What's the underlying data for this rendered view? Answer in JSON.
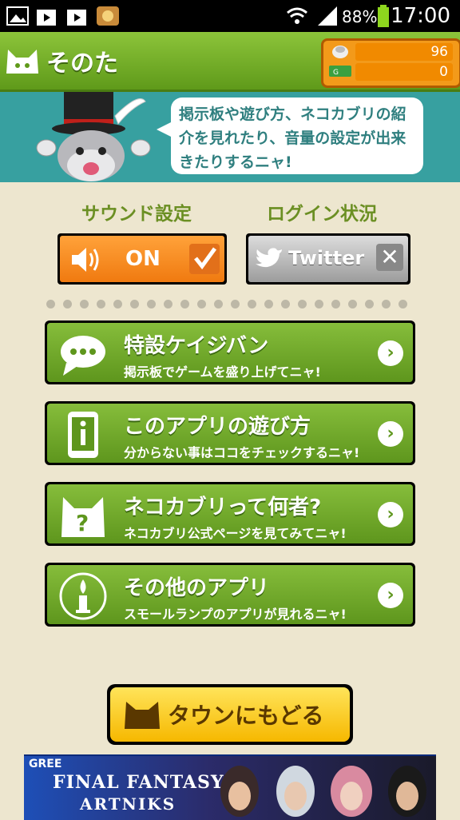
{
  "status_bar": {
    "battery": "88%",
    "time": "17:00"
  },
  "header": {
    "title": "そのた",
    "counter_top": "96",
    "counter_bottom": "0"
  },
  "banner": {
    "message": "掲示板や遊び方、ネコカブリの紹介を見れたり、音量の設定が出来きたりするニャ!"
  },
  "settings": {
    "sound_label": "サウンド設定",
    "sound_value": "ON",
    "login_label": "ログイン状況",
    "twitter_label": "Twitter"
  },
  "menu": [
    {
      "title": "特設ケイジバン",
      "subtitle": "掲示板でゲームを盛り上げてニャ!",
      "icon": "speech-bubble-icon"
    },
    {
      "title": "このアプリの遊び方",
      "subtitle": "分からない事はココをチェックするニャ!",
      "icon": "info-phone-icon"
    },
    {
      "title": "ネコカブリって何者?",
      "subtitle": "ネコカブリ公式ページを見てみてニャ!",
      "icon": "cat-question-icon"
    },
    {
      "title": "その他のアプリ",
      "subtitle": "スモールランプのアプリが見れるニャ!",
      "icon": "lamp-icon"
    }
  ],
  "town_button": {
    "label": "タウンにもどる"
  },
  "ad": {
    "brand": "GREE",
    "title": "FINAL FANTASY.",
    "subtitle": "ARTNIKS"
  },
  "colors": {
    "green": "#6aa526",
    "teal": "#37a0a0",
    "orange": "#f18a00",
    "yellow": "#f6b800"
  }
}
